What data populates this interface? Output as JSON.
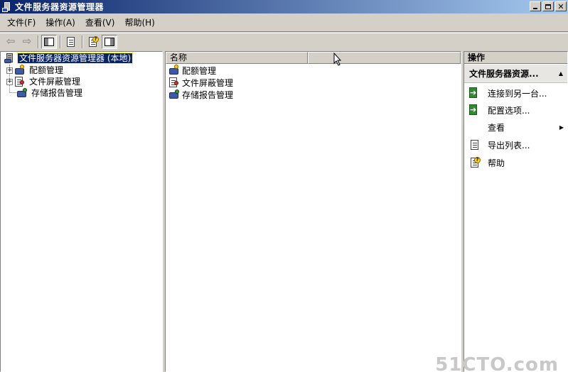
{
  "window": {
    "title": "文件服务器资源管理器",
    "controls": [
      "minimize",
      "restore",
      "close"
    ]
  },
  "menu": [
    "文件(F)",
    "操作(A)",
    "查看(V)",
    "帮助(H)"
  ],
  "toolbar": {
    "buttons": [
      "back-icon",
      "forward-icon",
      "show-hide-tree-icon",
      "export-list-icon",
      "help-icon",
      "show-hide-action-pane-icon"
    ]
  },
  "tree": {
    "root": "文件服务器资源管理器 (本地)",
    "children": [
      "配额管理",
      "文件屏蔽管理",
      "存储报告管理"
    ]
  },
  "list": {
    "column": "名称",
    "rows": [
      "配额管理",
      "文件屏蔽管理",
      "存储报告管理"
    ]
  },
  "actions": {
    "header": "操作",
    "section": "文件服务器资源...",
    "items": [
      "连接到另一台...",
      "配置选项...",
      "查看",
      "导出列表...",
      "帮助"
    ]
  },
  "watermark": "51CTO.com"
}
